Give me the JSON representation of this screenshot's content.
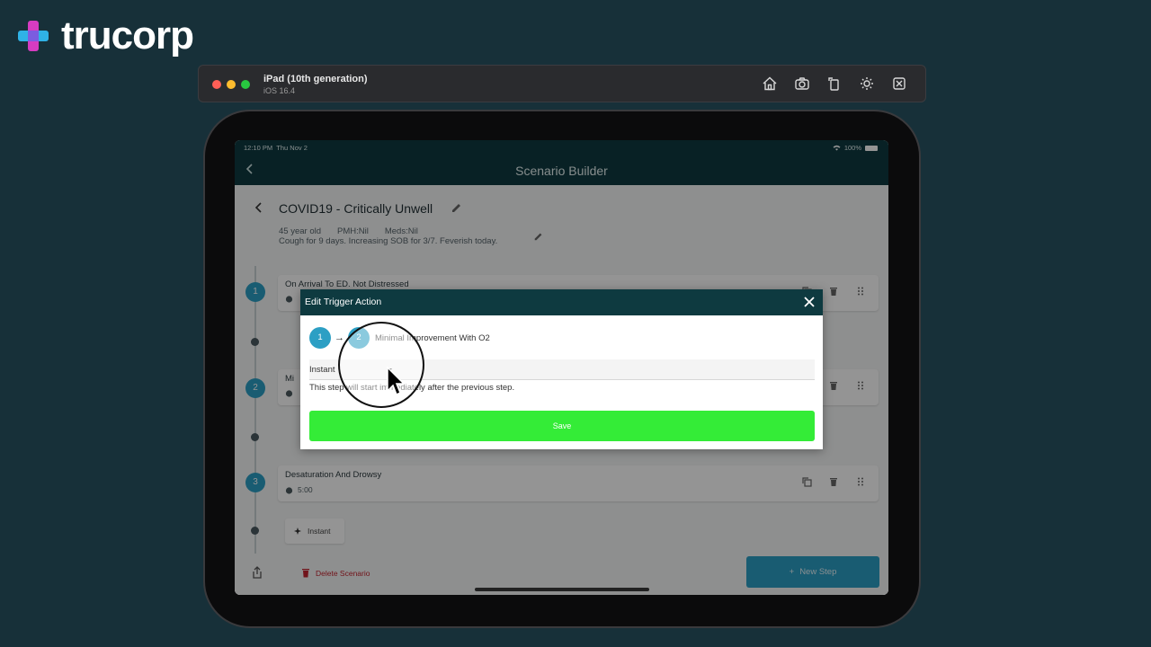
{
  "brand": {
    "name": "trucorp"
  },
  "simulator": {
    "device": "iPad (10th generation)",
    "os": "iOS 16.4"
  },
  "status_bar": {
    "time": "12:10 PM",
    "date": "Thu Nov 2",
    "battery": "100%"
  },
  "nav": {
    "title": "Scenario Builder"
  },
  "scenario": {
    "title": "COVID19 - Critically Unwell",
    "age": "45 year old",
    "pmh": "PMH:Nil",
    "meds": "Meds:Nil",
    "description": "Cough for 9 days. Increasing SOB for 3/7. Feverish today."
  },
  "steps": [
    {
      "number": "1",
      "title": "On Arrival To ED. Not Distressed",
      "duration": ""
    },
    {
      "number": "2",
      "title": "Mi",
      "duration": ""
    },
    {
      "number": "3",
      "title": "Desaturation And Drowsy",
      "duration": "5:00"
    }
  ],
  "triggers": [
    {
      "label": "Instant"
    }
  ],
  "actions": {
    "delete": "Delete Scenario",
    "new_step": "New Step"
  },
  "modal": {
    "title": "Edit Trigger Action",
    "from_step": "1",
    "to_step": "2",
    "to_step_name": "Minimal Improvement With O2",
    "trigger_type": "Instant",
    "help_text": "This step will start immediately after the previous step.",
    "save_label": "Save"
  },
  "colors": {
    "accent": "#2c9fc4",
    "header": "#0e3a40",
    "save": "#34ec37",
    "danger": "#c3242f"
  }
}
